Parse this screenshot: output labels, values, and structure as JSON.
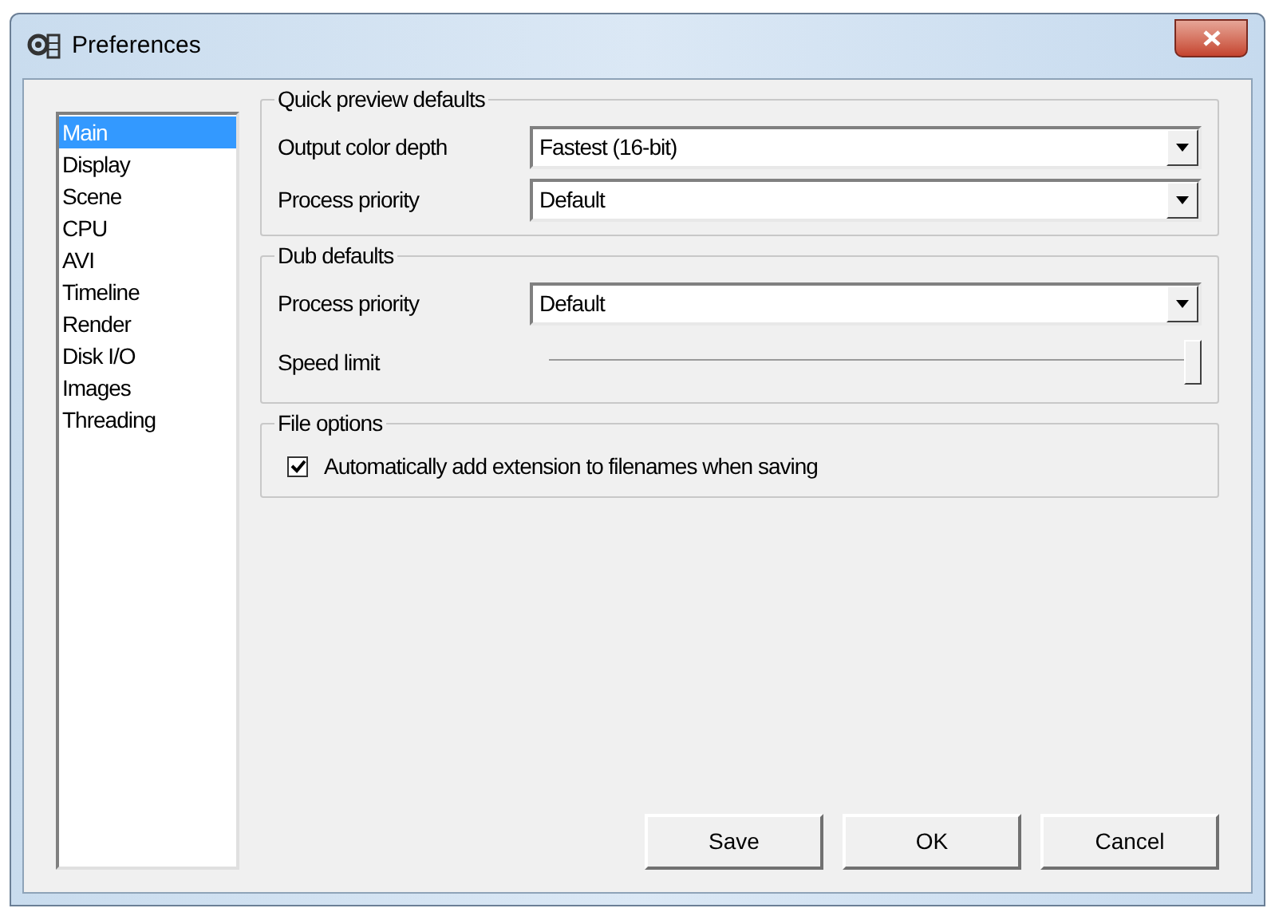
{
  "window": {
    "title": "Preferences"
  },
  "sidebar": {
    "items": [
      {
        "label": "Main",
        "selected": true
      },
      {
        "label": "Display",
        "selected": false
      },
      {
        "label": "Scene",
        "selected": false
      },
      {
        "label": "CPU",
        "selected": false
      },
      {
        "label": "AVI",
        "selected": false
      },
      {
        "label": "Timeline",
        "selected": false
      },
      {
        "label": "Render",
        "selected": false
      },
      {
        "label": "Disk I/O",
        "selected": false
      },
      {
        "label": "Images",
        "selected": false
      },
      {
        "label": "Threading",
        "selected": false
      }
    ]
  },
  "groups": [
    {
      "title": "Quick preview defaults",
      "rows": [
        {
          "kind": "dropdown",
          "label": "Output color depth",
          "value": "Fastest (16-bit)"
        },
        {
          "kind": "dropdown",
          "label": "Process priority",
          "value": "Default"
        }
      ]
    },
    {
      "title": "Dub defaults",
      "rows": [
        {
          "kind": "dropdown",
          "label": "Process priority",
          "value": "Default"
        },
        {
          "kind": "slider",
          "label": "Speed limit",
          "level": 1
        }
      ]
    },
    {
      "title": "File options",
      "rows": [
        {
          "kind": "checkbox",
          "label": "Automatically add extension to filenames when saving",
          "checked": true
        }
      ]
    }
  ],
  "buttons": [
    "Save",
    "OK",
    "Cancel"
  ]
}
